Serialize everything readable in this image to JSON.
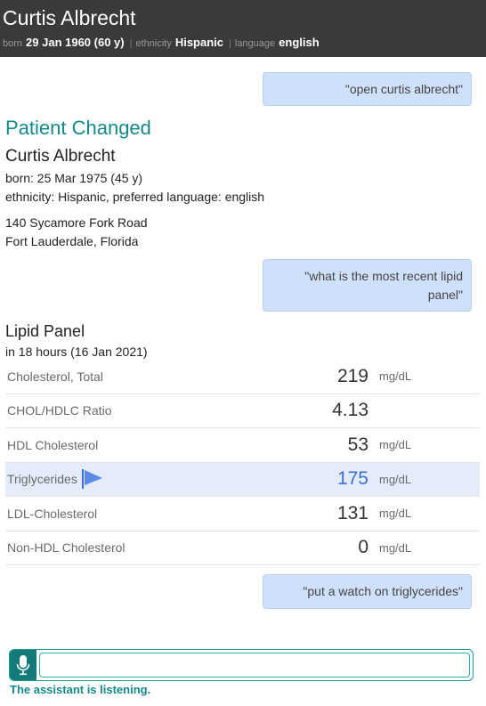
{
  "header": {
    "name": "Curtis Albrecht",
    "born_label": "born",
    "born_value": "29 Jan 1960 (60 y)",
    "ethnicity_label": "ethnicity",
    "ethnicity_value": "Hispanic",
    "language_label": "language",
    "language_value": "english",
    "separator": "|",
    "background": "#3a3a3a"
  },
  "chat": {
    "bubble1": "\"open curtis albrecht\"",
    "bubble2": "\"what is the most recent lipid panel\"",
    "bubble3": "\"put a watch on triglycerides\"",
    "bubble_color": "#cfe0fa"
  },
  "patient_changed": {
    "title": "Patient Changed",
    "name": "Curtis Albrecht",
    "born": "born: 25 Mar 1975 (45 y)",
    "ethnicity_language": "ethnicity: Hispanic, preferred language: english",
    "address_line1": "140 Sycamore Fork Road",
    "address_line2": "Fort Lauderdale, Florida",
    "title_color": "#138a8a"
  },
  "lipid_panel": {
    "title": "Lipid Panel",
    "when": "in 18 hours (16 Jan 2021)",
    "rows": [
      {
        "label": "Cholesterol, Total",
        "value": "219",
        "unit": "mg/dL"
      },
      {
        "label": "CHOL/HDLC Ratio",
        "value": "4.13",
        "unit": ""
      },
      {
        "label": "HDL Cholesterol",
        "value": "53",
        "unit": "mg/dL"
      },
      {
        "label": "Triglycerides",
        "value": "175",
        "unit": "mg/dL",
        "flag_icon": "flag-icon",
        "flag_color": "#3a6fd8"
      },
      {
        "label": "LDL-Cholesterol",
        "value": "131",
        "unit": "mg/dL"
      },
      {
        "label": "Non-HDL Cholesterol",
        "value": "0",
        "unit": "mg/dL"
      }
    ]
  },
  "assistant": {
    "mic_icon": "microphone-icon",
    "input_value": "",
    "status": "The assistant is listening.",
    "accent": "#138a8a"
  }
}
